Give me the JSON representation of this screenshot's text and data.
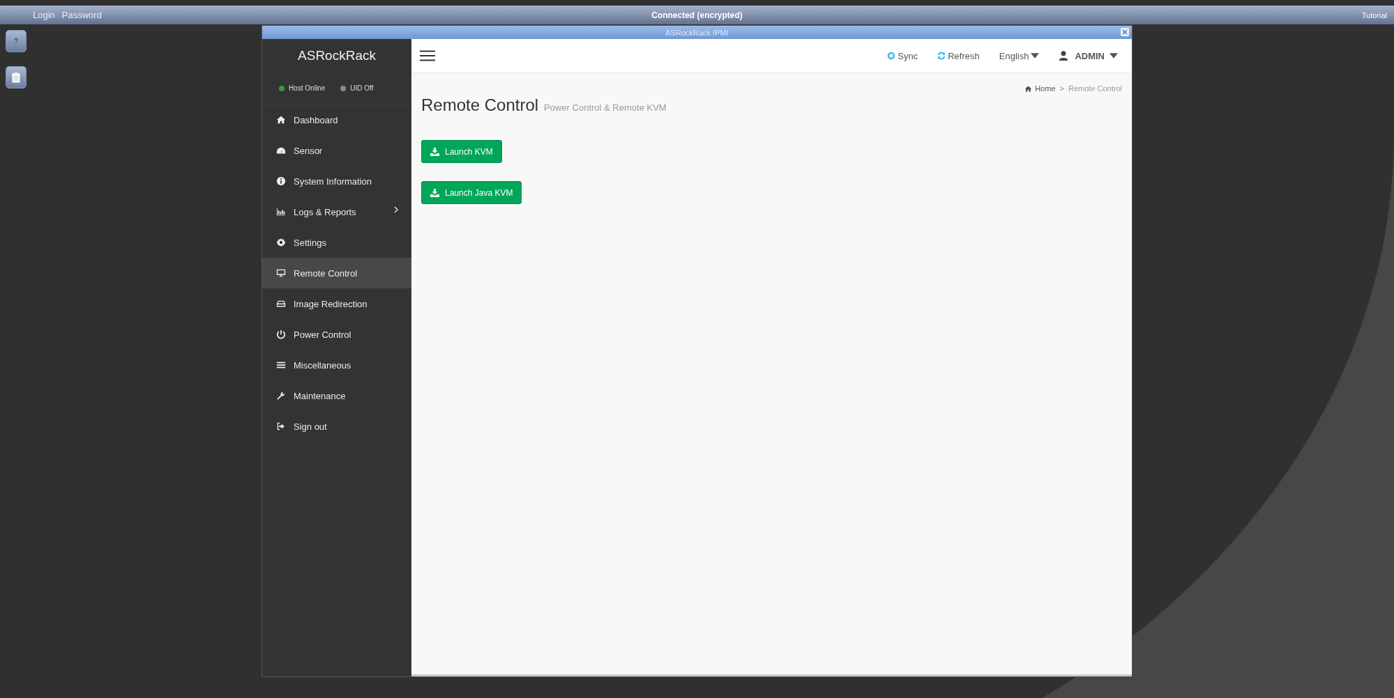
{
  "top_bar": {
    "login": "Login",
    "password": "Password",
    "status": "Connected (encrypted)",
    "tutorial": "Tutorial"
  },
  "side_tools": [
    {
      "kind": "help",
      "label": "?"
    },
    {
      "kind": "clipboard"
    }
  ],
  "window": {
    "title": "ASRockRack IPMI"
  },
  "sidebar": {
    "brand": "ASRockRack",
    "indicators": [
      {
        "label": "Host Online",
        "color": "#3c9a3c"
      },
      {
        "label": "UID Off",
        "color": "#8a8a8a"
      }
    ],
    "items": [
      {
        "label": "Dashboard",
        "selected": false,
        "submenu": false
      },
      {
        "label": "Sensor",
        "selected": false,
        "submenu": false
      },
      {
        "label": "System Information",
        "selected": false,
        "submenu": false
      },
      {
        "label": "Logs & Reports",
        "selected": false,
        "submenu": true
      },
      {
        "label": "Settings",
        "selected": false,
        "submenu": false
      },
      {
        "label": "Remote Control",
        "selected": true,
        "submenu": false
      },
      {
        "label": "Image Redirection",
        "selected": false,
        "submenu": false
      },
      {
        "label": "Power Control",
        "selected": false,
        "submenu": false
      },
      {
        "label": "Miscellaneous",
        "selected": false,
        "submenu": false
      },
      {
        "label": "Maintenance",
        "selected": false,
        "submenu": false
      },
      {
        "label": "Sign out",
        "selected": false,
        "submenu": false
      }
    ]
  },
  "header": {
    "sync": "Sync",
    "refresh": "Refresh",
    "language": "English",
    "user": "ADMIN"
  },
  "page": {
    "title": "Remote Control",
    "subtitle": "Power Control & Remote KVM",
    "breadcrumb": [
      "Home",
      "Remote Control"
    ],
    "breadcrumb_separator": ">",
    "buttons": [
      "Launch KVM",
      "Launch Java KVM"
    ]
  }
}
